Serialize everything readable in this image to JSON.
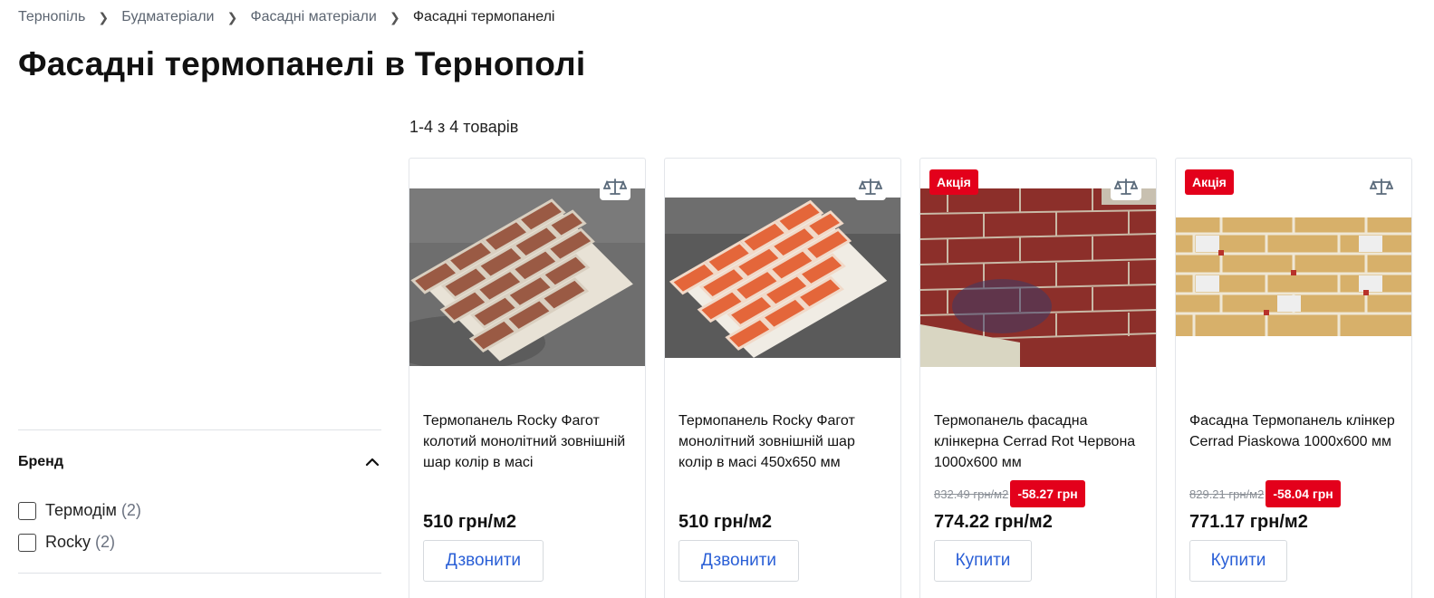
{
  "breadcrumb": {
    "items": [
      "Тернопіль",
      "Будматеріали",
      "Фасадні матеріали"
    ],
    "current": "Фасадні термопанелі"
  },
  "page_title": "Фасадні термопанелі в Тернополі",
  "results_count": "1-4 з 4 товарів",
  "filter": {
    "title": "Бренд",
    "options": [
      {
        "label": "Термодім",
        "count": "(2)"
      },
      {
        "label": "Rocky",
        "count": "(2)"
      }
    ]
  },
  "products": [
    {
      "name": "Термопанель Rocky Фагот колотий монолітний зовнішній шар колір в масі",
      "price": "510 грн/м2",
      "button": "Дзвонити",
      "image_icon": "rocky-split-brick-panel"
    },
    {
      "name": "Термопанель Rocky Фагот монолітний зовнішній шар колір в масі 450х650 мм",
      "price": "510 грн/м2",
      "button": "Дзвонити",
      "image_icon": "rocky-smooth-brick-panel"
    },
    {
      "badge": "Акція",
      "name": "Термопанель фасадна клінкерна Cerrad Rot Червона 1000х600 мм",
      "old_price": "832.49 грн/м2",
      "discount": "-58.27 грн",
      "price": "774.22 грн/м2",
      "button": "Купити",
      "image_icon": "red-clinker-wall"
    },
    {
      "badge": "Акція",
      "name": "Фасадна Термопанель клінкер Cerrad Piaskowa 1000х600 мм",
      "old_price": "829.21 грн/м2",
      "discount": "-58.04 грн",
      "price": "771.17 грн/м2",
      "button": "Купити",
      "image_icon": "sand-clinker-wall"
    }
  ],
  "colors": {
    "sale_red": "#e3001b",
    "link_blue": "#2a5fd6"
  }
}
